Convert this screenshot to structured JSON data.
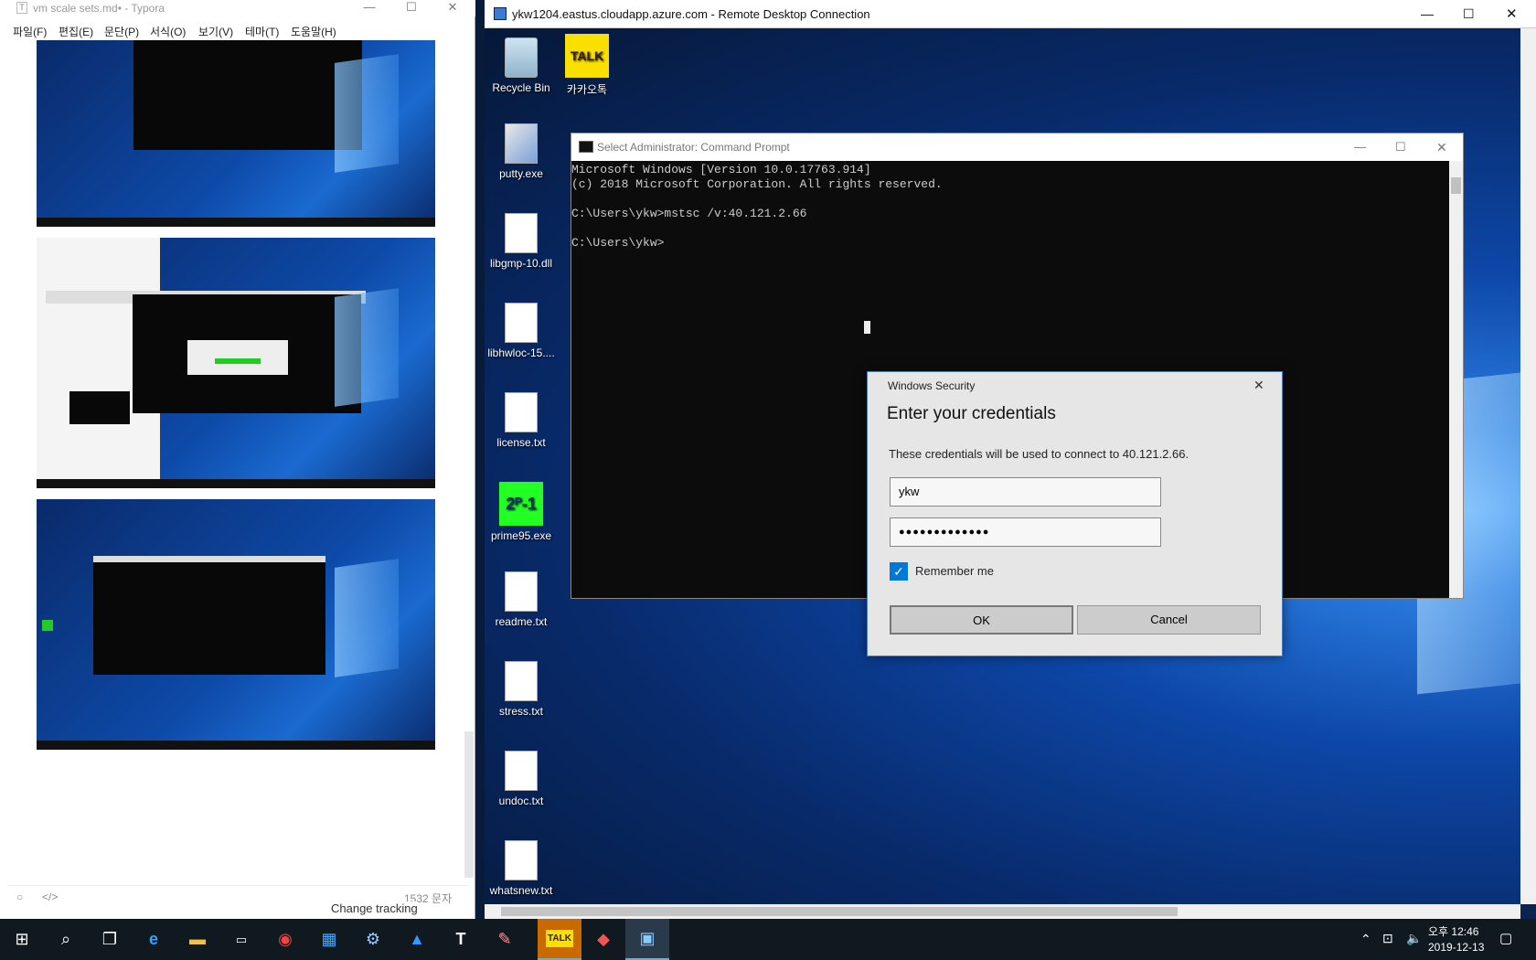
{
  "typora": {
    "title": "vm scale sets.md• - Typora",
    "menu": [
      "파일(F)",
      "편집(E)",
      "문단(P)",
      "서식(O)",
      "보기(V)",
      "테마(T)",
      "도움말(H)"
    ],
    "status_count": "1532 문자",
    "behind_text": "Change tracking"
  },
  "rdp": {
    "title": "ykw1204.eastus.cloudapp.azure.com - Remote Desktop Connection"
  },
  "desktop_icons": [
    {
      "label": "Recycle Bin",
      "icon": "recycle-bin-icon"
    },
    {
      "label": "카카오톡",
      "icon": "kakaotalk-icon"
    },
    {
      "label": "putty.exe",
      "icon": "putty-icon"
    },
    {
      "label": "libgmp-10.dll",
      "icon": "dll-file-icon"
    },
    {
      "label": "libhwloc-15....",
      "icon": "dll-file-icon"
    },
    {
      "label": "license.txt",
      "icon": "text-file-icon"
    },
    {
      "label": "prime95.exe",
      "icon": "prime95-icon"
    },
    {
      "label": "readme.txt",
      "icon": "text-file-icon"
    },
    {
      "label": "stress.txt",
      "icon": "text-file-icon"
    },
    {
      "label": "undoc.txt",
      "icon": "text-file-icon"
    },
    {
      "label": "whatsnew.txt",
      "icon": "text-file-icon"
    }
  ],
  "cmd": {
    "title": "Select Administrator: Command Prompt",
    "lines": "Microsoft Windows [Version 10.0.17763.914]\n(c) 2018 Microsoft Corporation. All rights reserved.\n\nC:\\Users\\ykw>mstsc /v:40.121.2.66\n\nC:\\Users\\ykw>"
  },
  "dialog": {
    "window_title": "Windows Security",
    "heading": "Enter your credentials",
    "message": "These credentials will be used to connect to 40.121.2.66.",
    "username": "ykw",
    "password_mask": "●●●●●●●●●●●●●",
    "remember_label": "Remember me",
    "remember_checked": true,
    "ok_label": "OK",
    "cancel_label": "Cancel"
  },
  "taskbar": {
    "time": "오후 12:46",
    "date": "2019-12-13",
    "icons": [
      "start-icon",
      "search-icon",
      "task-view-icon",
      "edge-icon",
      "file-explorer-icon",
      "cmd-icon",
      "chrome-icon",
      "office-icon",
      "network-tool-icon",
      "azure-icon",
      "typora-icon",
      "paint-icon",
      "kakaotalk-icon",
      "git-icon",
      "remote-desktop-icon"
    ]
  },
  "colors": {
    "accent": "#0078d7",
    "taskbar": "#101820",
    "dialog_bg": "#e6e6e6"
  }
}
